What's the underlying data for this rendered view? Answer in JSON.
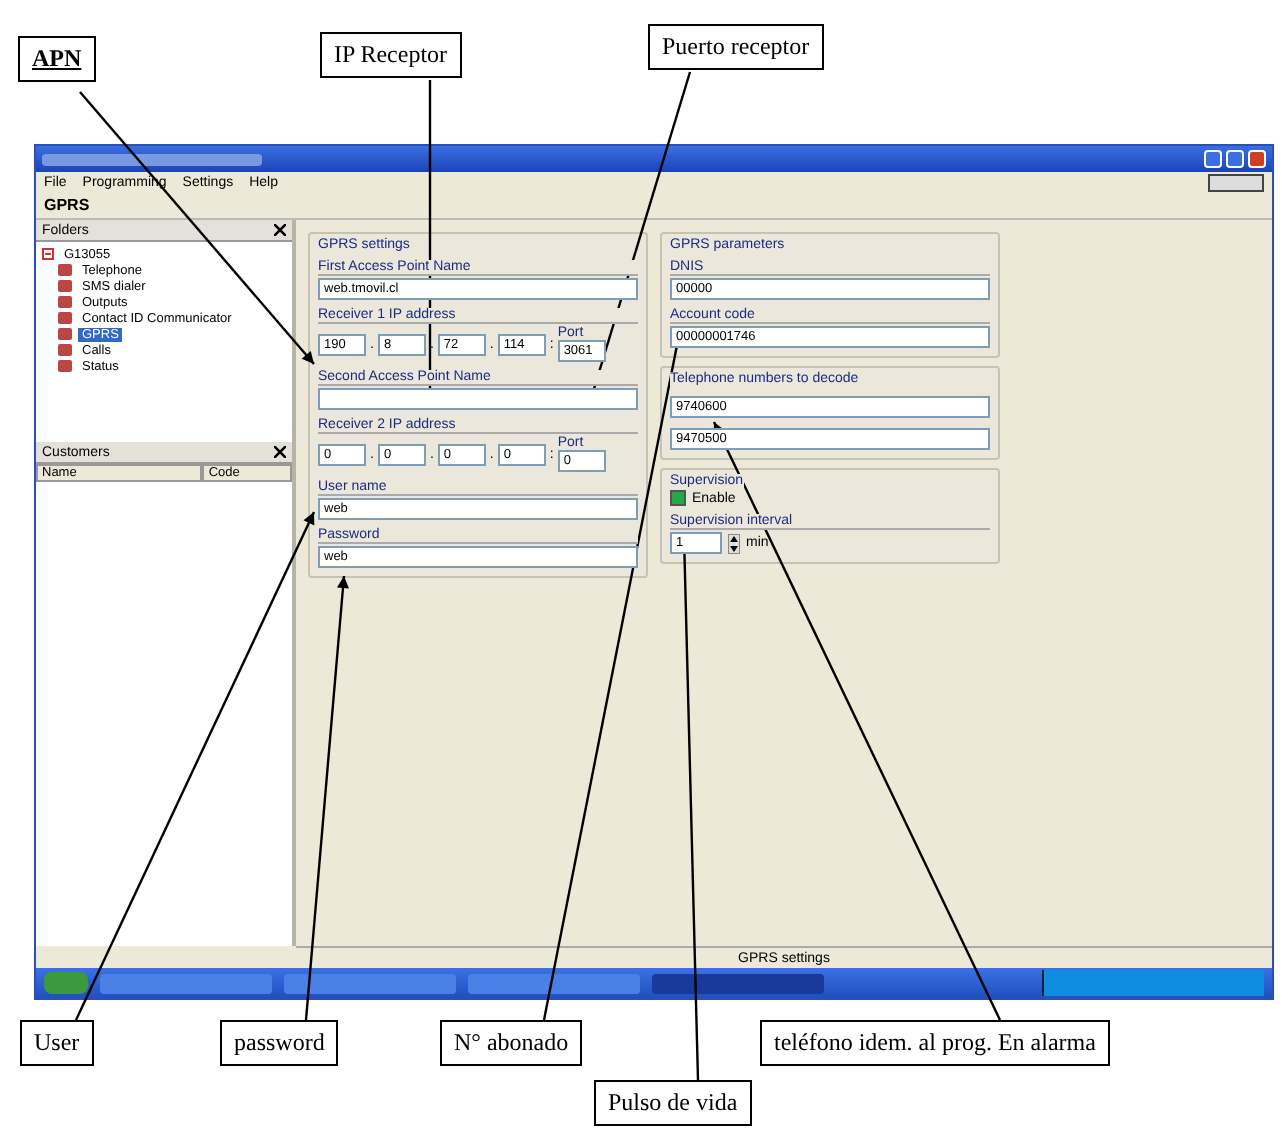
{
  "callouts": [
    {
      "text": "APN",
      "emphasis": true
    },
    {
      "text": "IP Receptor",
      "emphasis": false
    },
    {
      "text": "Puerto receptor",
      "emphasis": false
    },
    {
      "text": "User",
      "emphasis": false
    },
    {
      "text": "password",
      "emphasis": false
    },
    {
      "text": "N° abonado",
      "emphasis": false
    },
    {
      "text": "Pulso de vida",
      "emphasis": false
    },
    {
      "text": "teléfono idem. al prog. En alarma",
      "emphasis": false
    }
  ],
  "window": {
    "menu": [
      "File",
      "Programming",
      "Settings",
      "Help"
    ],
    "section_title": "GPRS",
    "folders": {
      "title": "Folders",
      "items": [
        {
          "label": "G13055",
          "expanded": true,
          "selected": false,
          "children": [
            {
              "label": "Telephone",
              "selected": false
            },
            {
              "label": "SMS dialer",
              "selected": false
            },
            {
              "label": "Outputs",
              "selected": false
            },
            {
              "label": "Contact ID Communicator",
              "selected": false
            },
            {
              "label": "GPRS",
              "selected": true
            },
            {
              "label": "Calls",
              "selected": false
            },
            {
              "label": "Status",
              "selected": false
            }
          ]
        }
      ]
    },
    "customers": {
      "title": "Customers",
      "columns": [
        "Name",
        "Code"
      ]
    },
    "gprs_settings": {
      "title": "GPRS settings",
      "first_apn": {
        "label": "First Access Point Name",
        "value": "web.tmovil.cl"
      },
      "receiver_1": {
        "label": "Receiver 1 IP address",
        "octets": [
          "190",
          "8",
          "72",
          "114"
        ],
        "separator": ".",
        "port_separator": ":",
        "port_label": "Port",
        "port": "3061"
      },
      "second_apn": {
        "label": "Second Access Point Name"
      },
      "receiver_2": {
        "label": "Receiver 2 IP address",
        "octets": [
          "0",
          "0",
          "0",
          "0"
        ],
        "separator": ".",
        "port_separator": ":",
        "port_label": "Port",
        "port": "0"
      },
      "user": {
        "label": "User name",
        "value": "web"
      },
      "password": {
        "label": "Password",
        "value": "web"
      }
    },
    "gprs_parameters": {
      "title": "GPRS parameters",
      "dnis": {
        "label": "DNIS",
        "value": "00000"
      },
      "account": {
        "label": "Account code",
        "value": "00000001746"
      }
    },
    "telephones": {
      "title": "Telephone numbers to decode",
      "numbers": [
        "9740600",
        "9470500"
      ]
    },
    "supervision": {
      "title": "Supervision",
      "enable": {
        "label": "Enable",
        "checked": true
      },
      "interval_label": "Supervision interval",
      "interval": "1",
      "unit": "min"
    },
    "status_bar": "GPRS settings"
  }
}
